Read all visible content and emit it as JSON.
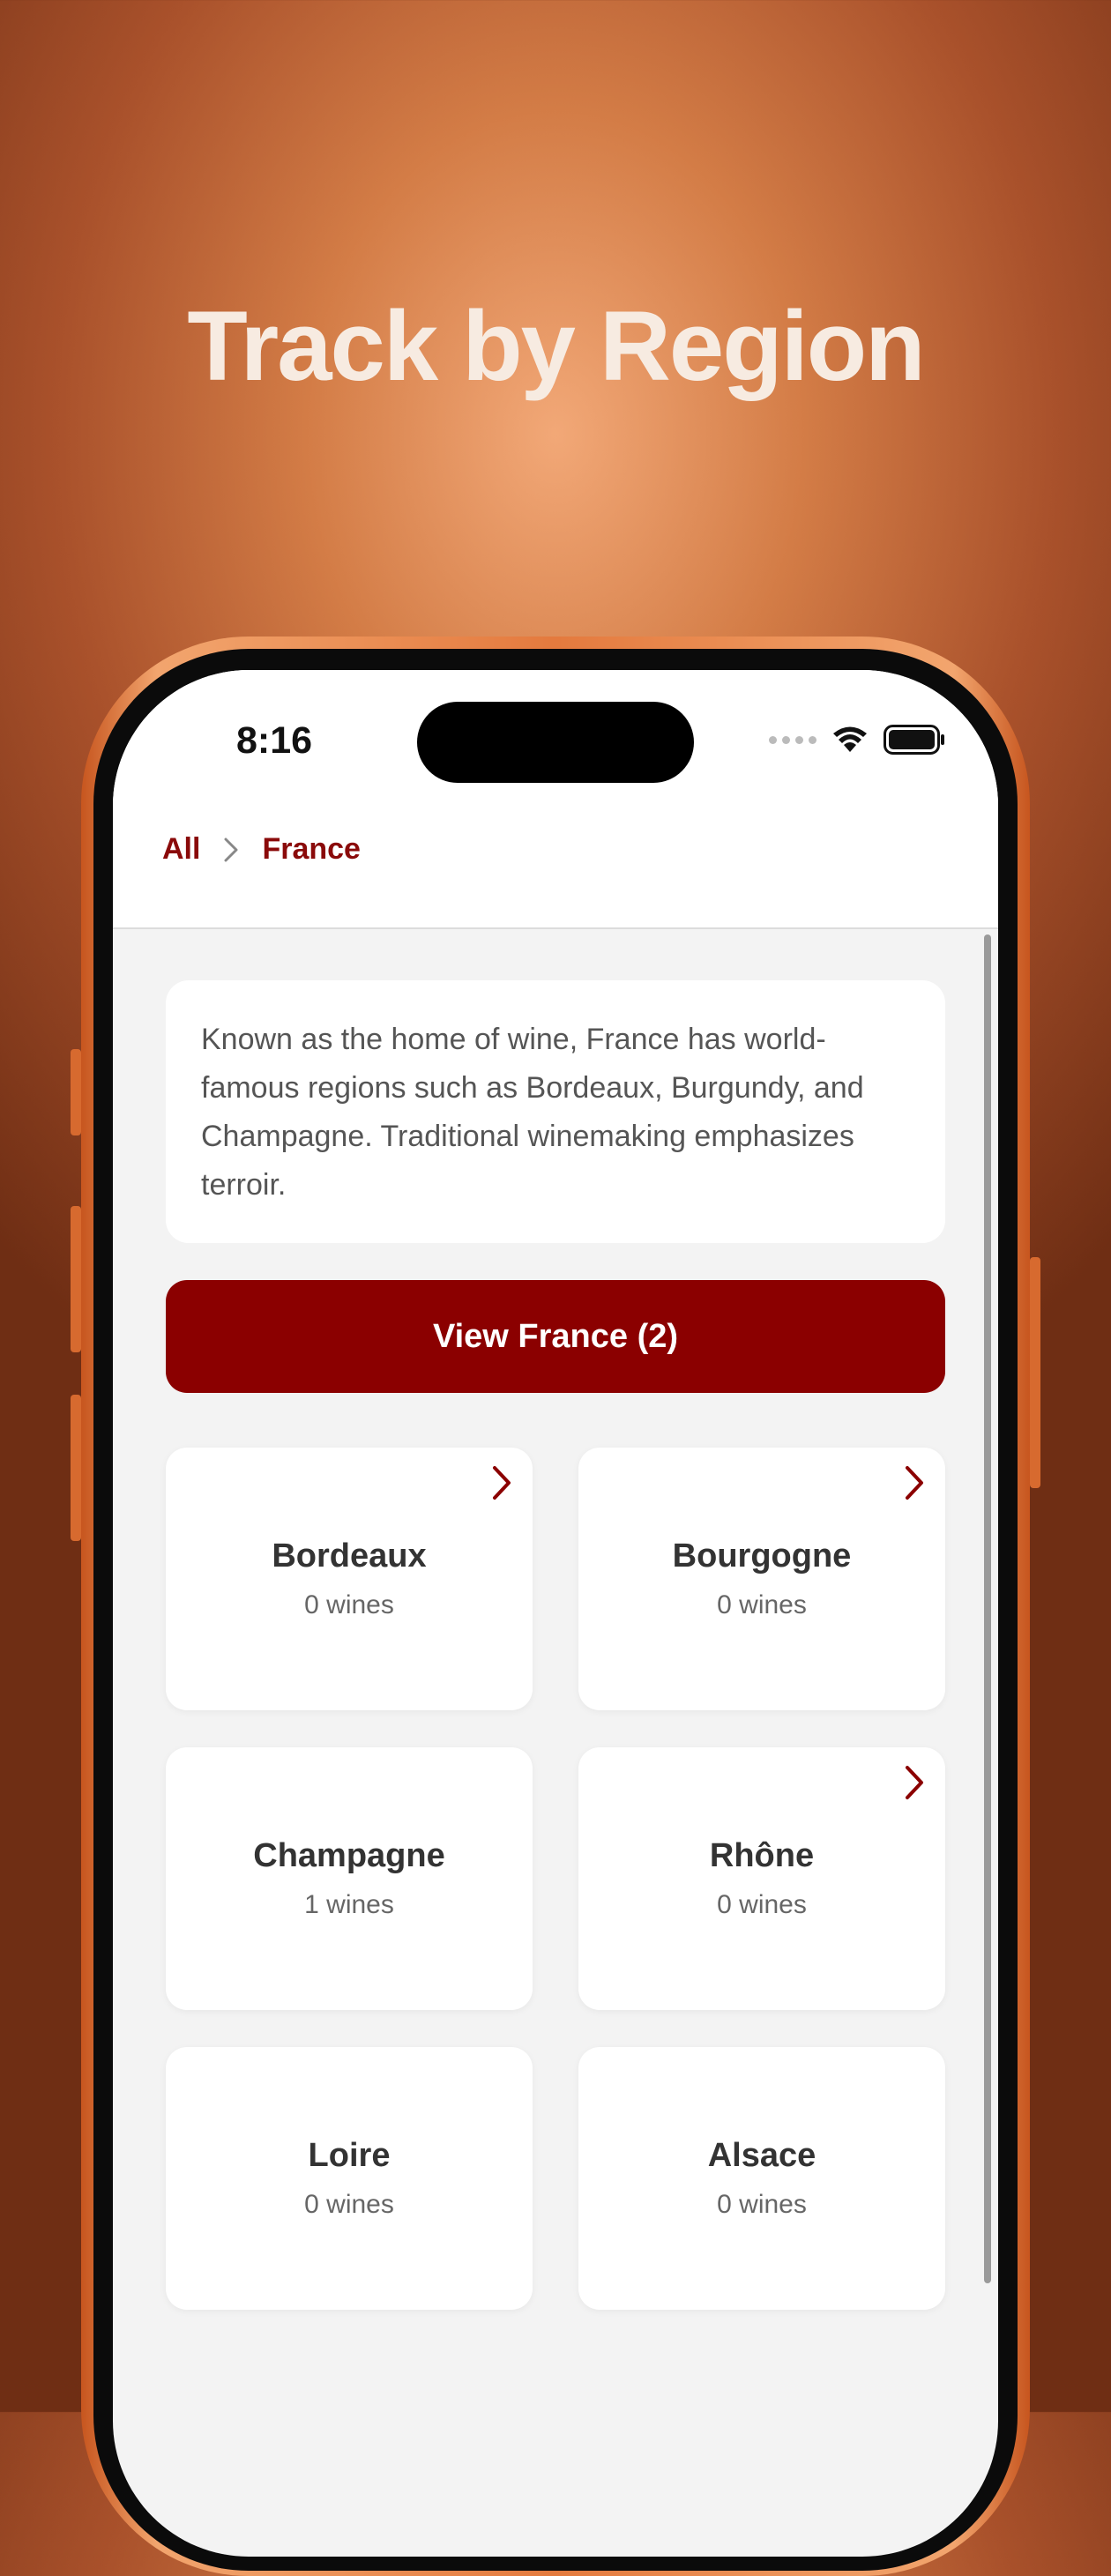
{
  "headline": "Track by Region",
  "status_bar": {
    "time": "8:16"
  },
  "breadcrumb": {
    "root": "All",
    "current": "France"
  },
  "description": "Known as the home of wine, France has world-famous regions such as Bordeaux, Burgundy, and Champagne. Traditional winemaking emphasizes terroir.",
  "view_button": "View France (2)",
  "regions": [
    {
      "name": "Bordeaux",
      "count": "0 wines",
      "has_chevron": true
    },
    {
      "name": "Bourgogne",
      "count": "0 wines",
      "has_chevron": true
    },
    {
      "name": "Champagne",
      "count": "1 wines",
      "has_chevron": false
    },
    {
      "name": "Rhône",
      "count": "0 wines",
      "has_chevron": true
    },
    {
      "name": "Loire",
      "count": "0 wines",
      "has_chevron": false
    },
    {
      "name": "Alsace",
      "count": "0 wines",
      "has_chevron": false
    }
  ],
  "colors": {
    "accent": "#8b0000",
    "background_warm": "#c46a3a"
  },
  "icons": [
    "wifi-icon",
    "battery-icon",
    "signal-icon",
    "chevron-right-icon",
    "breadcrumb-chevron-icon"
  ]
}
